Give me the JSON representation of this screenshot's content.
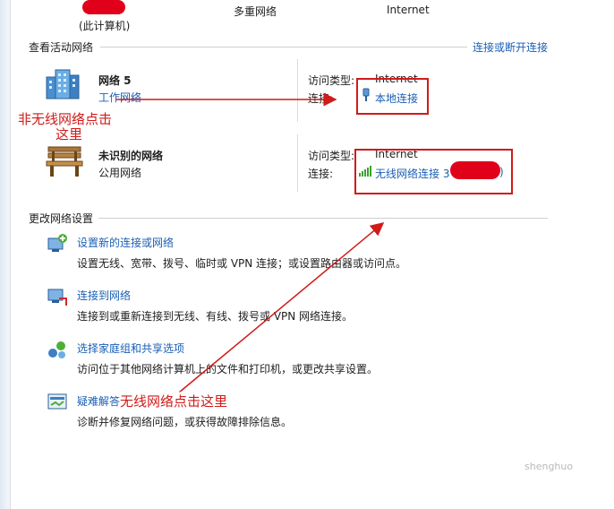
{
  "top": {
    "computer_label": "(此计算机)",
    "multiple_networks": "多重网络",
    "internet": "Internet"
  },
  "active_networks": {
    "title": "查看活动网络",
    "connect_link": "连接或断开连接",
    "networks": [
      {
        "name": "网络  5",
        "type": "工作网络",
        "access_type_label": "访问类型:",
        "access_type_value": "Internet",
        "connections_label": "连接:",
        "connection": "本地连接"
      },
      {
        "name": "未识别的网络",
        "type": "公用网络",
        "access_type_label": "访问类型:",
        "access_type_value": "Internet",
        "connections_label": "连接:",
        "connection": "无线网络连接 3",
        "connection_suffix": ")"
      }
    ]
  },
  "change_settings": {
    "title": "更改网络设置",
    "items": [
      {
        "title": "设置新的连接或网络",
        "description": "设置无线、宽带、拨号、临时或 VPN 连接；或设置路由器或访问点。"
      },
      {
        "title": "连接到网络",
        "description": "连接到或重新连接到无线、有线、拨号或 VPN 网络连接。"
      },
      {
        "title": "选择家庭组和共享选项",
        "description": "访问位于其他网络计算机上的文件和打印机，或更改共享设置。"
      },
      {
        "title": "疑难解答",
        "description": "诊断并修复网络问题，或获得故障排除信息。"
      }
    ]
  },
  "annotations": {
    "wired_line1": "非无线网络点击",
    "wired_line2": "这里",
    "wireless": "无线网络点击这里"
  },
  "watermark": "shenghuo",
  "colors": {
    "link": "#1a5fb4",
    "annotation": "#d11a1a",
    "signal": "#3ba02e"
  }
}
